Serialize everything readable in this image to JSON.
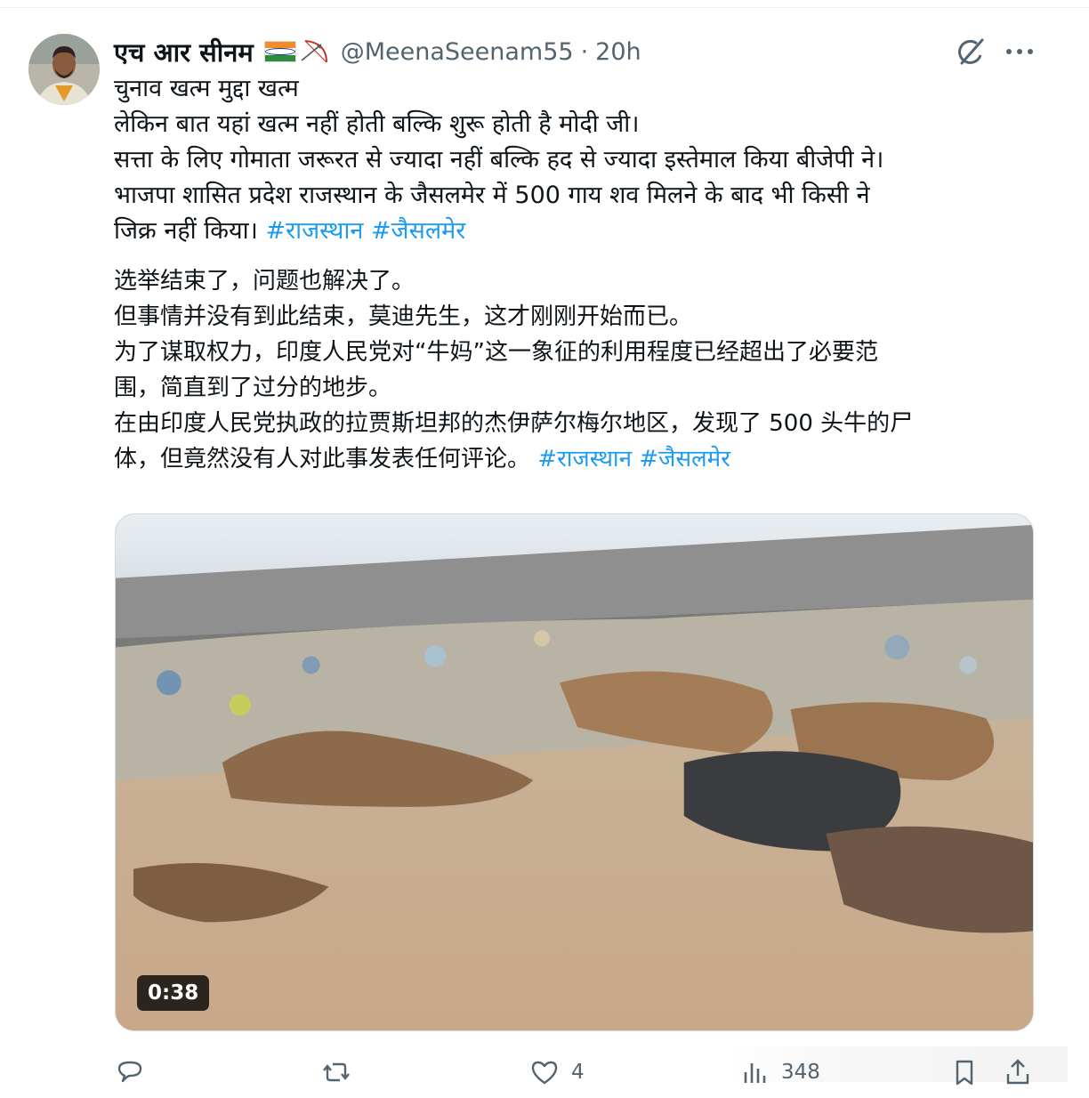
{
  "author": {
    "display_name": "एच आर सीनम",
    "handle": "@MeenaSeenam55",
    "separator": "·",
    "time": "20h"
  },
  "icons": {
    "flag": "india-flag-icon",
    "bow": "bow-arrow-icon",
    "grok": "grok-icon",
    "more": "more-icon"
  },
  "tweet": {
    "hindi_lines": [
      "चुनाव खत्म मुद्दा खत्म",
      "लेकिन बात यहां खत्म नहीं होती बल्कि शुरू होती है मोदी जी।",
      "सत्ता के लिए गोमाता जरूरत से ज्यादा नहीं बल्कि हद से ज्यादा इस्तेमाल किया बीजेपी ने।",
      "भाजपा शासित प्रदेश राजस्थान के जैसलमेर में 500 गाय शव मिलने के बाद भी किसी ने",
      "जिक्र नहीं किया।"
    ],
    "hashtag_1": "#राजस्थान",
    "hashtag_2": "#जैसलमेर",
    "chinese_lines": [
      "选举结束了，问题也解决了。",
      "但事情并没有到此结束，莫迪先生，这才刚刚开始而已。",
      "为了谋取权力，印度人民党对“牛妈”这一象征的利用程度已经超出了必要范",
      "围，简直到了过分的地步。",
      "在由印度人民党执政的拉贾斯坦邦的杰伊萨尔梅尔地区，发现了 500 头牛的尸",
      "体，但竟然没有人对此事发表任何评论。"
    ]
  },
  "media": {
    "duration": "0:38"
  },
  "actions": {
    "reply_icon": "reply-icon",
    "retweet_icon": "retweet-icon",
    "like_icon": "heart-icon",
    "like_count": "4",
    "views_icon": "views-icon",
    "views_count": "348",
    "bookmark_icon": "bookmark-icon",
    "share_icon": "share-icon"
  }
}
